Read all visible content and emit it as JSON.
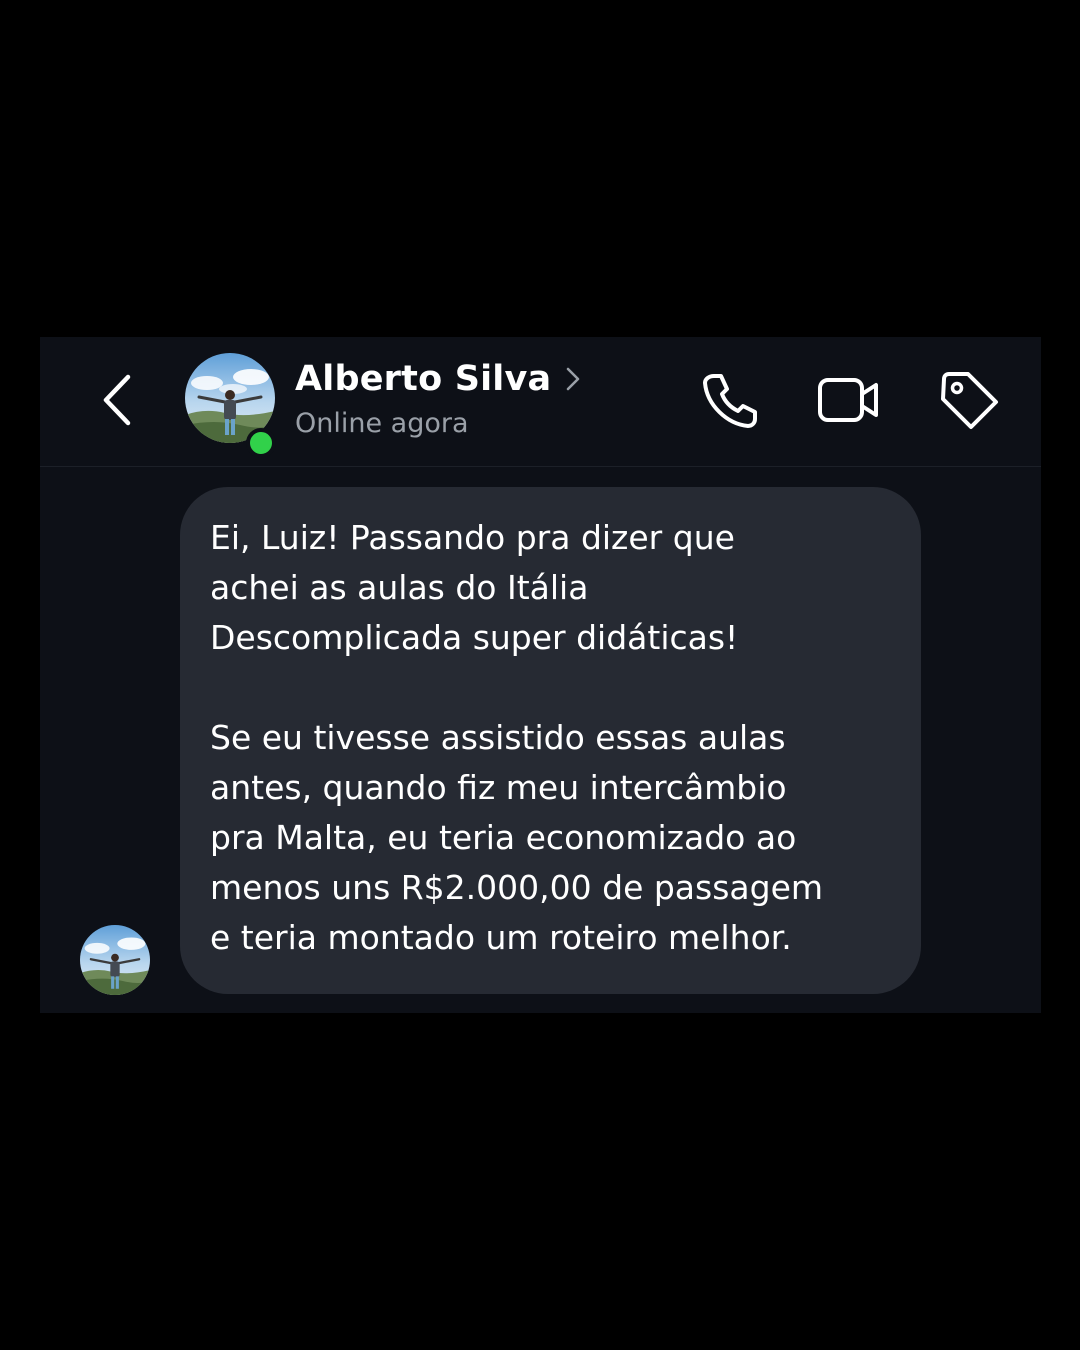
{
  "contact": {
    "name": "Alberto Silva",
    "status": "Online agora",
    "online_color": "#31d14a"
  },
  "header": {
    "back_icon": "chevron-left-icon",
    "actions": [
      {
        "name": "audio-call-button",
        "icon": "phone-icon"
      },
      {
        "name": "video-call-button",
        "icon": "video-camera-icon"
      },
      {
        "name": "tag-button",
        "icon": "tag-icon"
      }
    ]
  },
  "message": {
    "paragraphs": [
      "Ei, Luiz! Passando pra dizer que\nachei as aulas do Itália\nDescomplicada super didáticas!",
      "Se eu tivesse assistido essas aulas\nantes, quando fiz meu intercâmbio\npra Malta, eu teria economizado ao\nmenos uns R$2.000,00 de passagem\ne teria montado um roteiro melhor."
    ]
  },
  "colors": {
    "page_background": "#000000",
    "panel_background": "#0d1017",
    "bubble_background": "#262a33",
    "text_primary": "#ffffff",
    "text_secondary": "#9aa0a8"
  }
}
